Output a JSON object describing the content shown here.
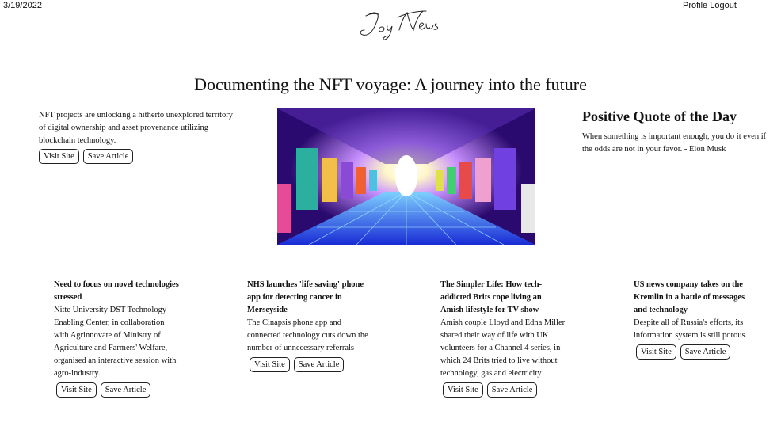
{
  "header": {
    "date": "3/19/2022",
    "nav": {
      "profile": "Profile",
      "logout": "Logout"
    },
    "logo_text": "Joy News"
  },
  "main": {
    "headline": "Documenting the NFT voyage: A journey into the future",
    "lead": {
      "summary": "NFT projects are unlocking a hitherto unexplored territory of digital ownership and asset provenance utilizing blockchain technology.",
      "visit_label": "Visit Site",
      "save_label": "Save Article"
    },
    "hero_image": {
      "description_icon": "nft-gallery-tunnel-image"
    },
    "quote": {
      "title": "Positive Quote of the Day",
      "text": "When something is important enough, you do it even if the odds are not in your favor. - Elon Musk"
    }
  },
  "articles": [
    {
      "title": "Need to focus on novel technologies stressed",
      "summary": "Nitte University DST Technology Enabling Center, in collaboration with Agrinnovate of Ministry of Agriculture and Farmers' Welfare, organised an interactive session with agro-industry.",
      "visit_label": "Visit Site",
      "save_label": "Save Article"
    },
    {
      "title": "NHS launches 'life saving' phone app for detecting cancer in Merseyside",
      "summary": "The Cinapsis phone app and connected technology cuts down the number of unnecessary referrals",
      "visit_label": "Visit Site",
      "save_label": "Save Article"
    },
    {
      "title": "The Simpler Life: How tech-addicted Brits cope living an Amish lifestyle for TV show",
      "summary": "Amish couple Lloyd and Edna Miller shared their way of life with UK volunteers for a Channel 4 series, in which 24 Brits tried to live without technology, gas and electricity",
      "visit_label": "Visit Site",
      "save_label": "Save Article"
    },
    {
      "title": "US news company takes on the Kremlin in a battle of messages and technology",
      "summary": "Despite all of Russia's efforts, its information system is still porous.",
      "visit_label": "Visit Site",
      "save_label": "Save Article"
    }
  ]
}
